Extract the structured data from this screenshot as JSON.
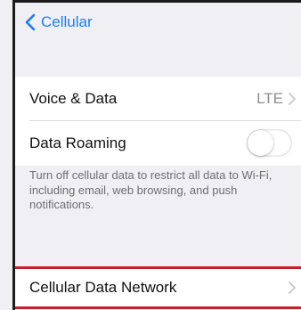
{
  "nav": {
    "back_label": "Cellular"
  },
  "rows": {
    "voice_data": {
      "label": "Voice & Data",
      "value": "LTE"
    },
    "data_roaming": {
      "label": "Data Roaming",
      "toggle_on": false
    }
  },
  "footer": "Turn off cellular data to restrict all data to Wi-Fi, including email, web browsing, and push notifications.",
  "cellular_data_network": {
    "label": "Cellular Data Network"
  },
  "colors": {
    "accent": "#1a7ef6",
    "highlight_border": "#c8202b",
    "background": "#efeff4"
  },
  "icons": {
    "back": "chevron-left-icon",
    "disclosure": "chevron-right-icon"
  }
}
